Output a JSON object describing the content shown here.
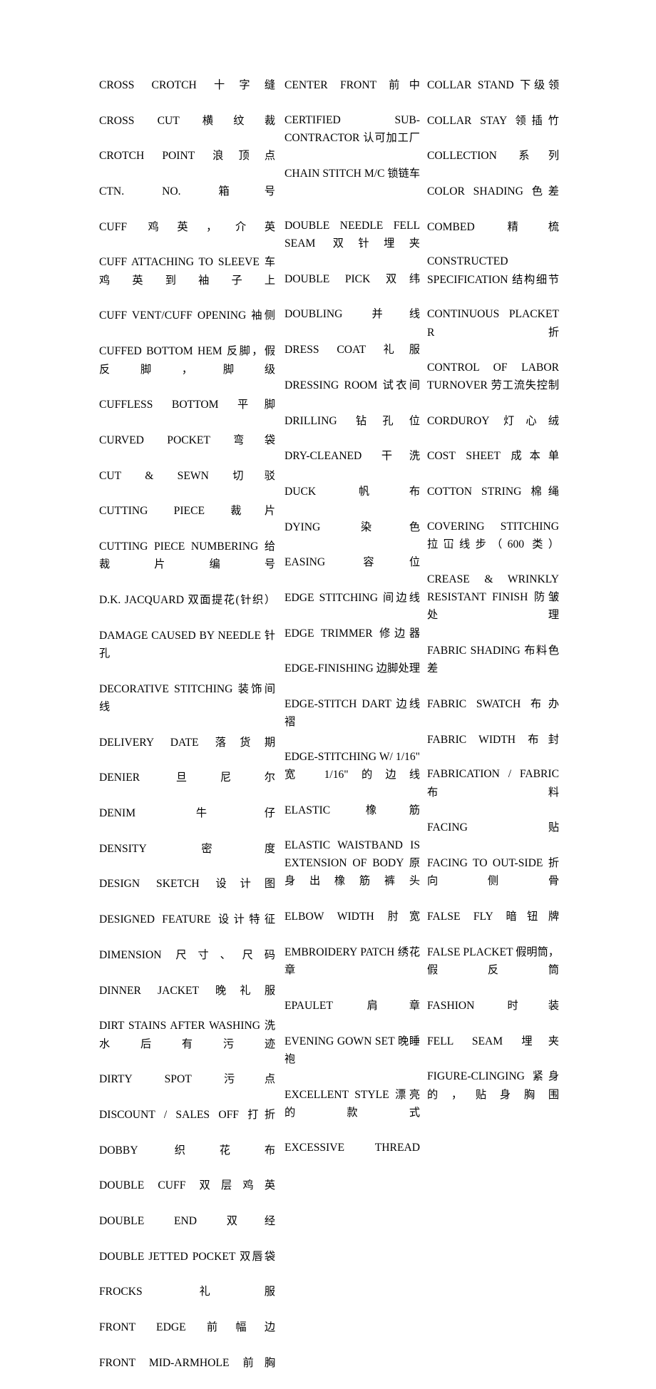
{
  "document": {
    "type": "glossary",
    "title": "Garment / Apparel English-Chinese Terminology Glossary",
    "layout": "three-column justified text",
    "page_background": "#ffffff",
    "text_color": "#000000"
  },
  "columns": [
    {
      "id": "column-1",
      "entries": [
        "CROSS CROTCH 十字缝",
        "CROSS CUT 横纹裁",
        "CROTCH POINT 浪顶点",
        "CTN. NO. 箱号",
        "CUFF 鸡英，介英",
        "CUFF ATTACHING TO SLEEVE 车鸡英到袖子上",
        "CUFF VENT/CUFF OPENING 袖侧",
        "CUFFED BOTTOM HEM 反脚，假反脚，脚级",
        "CUFFLESS BOTTOM 平脚",
        "CURVED POCKET 弯袋",
        "CUT & SEWN 切驳",
        "CUTTING PIECE 裁片",
        "CUTTING PIECE NUMBERING 给裁片编号",
        "D.K. JACQUARD 双面提花(针织）",
        "DAMAGE CAUSED BY NEEDLE 针孔",
        "DECORATIVE STITCHING 装饰间线",
        "DELIVERY DATE 落货期",
        "DENIER 旦尼尔",
        "DENIM 牛仔",
        "DENSITY 密度",
        "DESIGN SKETCH 设计图",
        "DESIGNED FEATURE 设计特征",
        "DIMENSION 尺寸、尺码",
        "DINNER JACKET 晚礼服",
        "DIRT STAINS AFTER WASHING 洗水后有污迹",
        "DIRTY SPOT 污点",
        "DISCOUNT / SALES OFF 打折",
        "DOBBY 织花布",
        "DOUBLE CUFF 双层鸡英",
        "DOUBLE END 双经",
        "DOUBLE JETTED POCKET 双唇袋",
        "FROCKS 礼服",
        "FRONT EDGE 前幅边",
        "FRONT MID-ARMHOLE 前胸"
      ]
    },
    {
      "id": "column-2",
      "entries": [
        "CENTER FRONT 前中",
        "CERTIFIED SUB-CONTRACTOR 认可加工厂",
        "CHAIN STITCH M/C 锁链车",
        "",
        "DOUBLE NEEDLE FELL SEAM 双针埋夹",
        "DOUBLE PICK 双纬",
        "DOUBLING 并线",
        "DRESS COAT 礼服",
        "DRESSING ROOM 试衣间",
        "DRILLING 钻孔位",
        "DRY-CLEANED 干洗",
        "DUCK 帆布",
        "DYING 染色",
        "EASING 容位",
        "EDGE STITCHING 间边线",
        "EDGE TRIMMER 修边器",
        "EDGE-FINISHING 边脚处理",
        "EDGE-STITCH DART 边线褶",
        "EDGE-STITCHING W/ 1/16\" 宽 1/16\"的边线",
        "ELASTIC 橡筋",
        "ELASTIC WAISTBAND IS EXTENSION OF BODY 原身出橡筋裤头",
        "ELBOW WIDTH 肘宽",
        "EMBROIDERY PATCH 绣花章",
        "EPAULET 肩章",
        "EVENING GOWN SET 晚睡袍",
        "EXCELLENT STYLE 漂亮的款式",
        "EXCESSIVE THREAD"
      ]
    },
    {
      "id": "column-3",
      "entries": [
        "COLLAR STAND 下级领",
        "COLLAR STAY 领插竹",
        "COLLECTION 系列",
        "COLOR SHADING 色差",
        "COMBED 精梳",
        "CONSTRUCTED SPECIFICATION 结构细节",
        "CONTINUOUS PLACKET R 折",
        "CONTROL OF LABOR TURNOVER 劳工流失控制",
        "CORDUROY 灯心绒",
        "COST SHEET 成本单",
        "COTTON STRING 棉绳",
        "COVERING STITCHING 拉冚线步（600 类）",
        "CREASE & WRINKLY RESISTANT FINISH 防皱处理",
        "FABRIC SHADING 布料色差",
        "FABRIC SWATCH 布办",
        "FABRIC WIDTH 布封",
        "FABRICATION / FABRIC 布料",
        "FACING 贴",
        "FACING TO OUT-SIDE 折向侧骨",
        "FALSE FLY 暗钮牌",
        "FALSE PLACKET 假明筒，假反筒",
        "FASHION 时装",
        "FELL SEAM 埋夹",
        "FIGURE-CLINGING 紧身的，贴身胸围"
      ]
    }
  ]
}
